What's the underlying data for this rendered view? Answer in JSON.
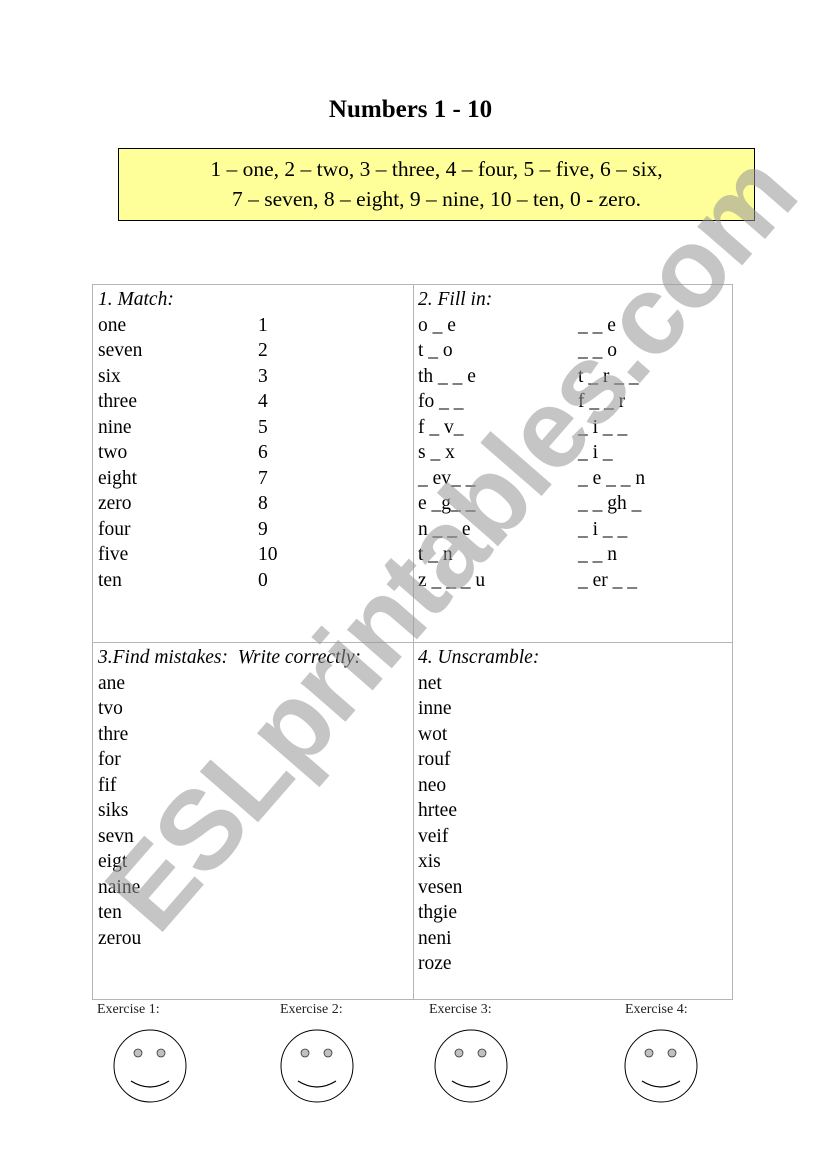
{
  "title": "Numbers 1 - 10",
  "reference": {
    "line1": "1 – one, 2 – two, 3 – three, 4 – four, 5 – five, 6 – six,",
    "line2": "7 – seven, 8 – eight, 9 – nine, 10 – ten, 0 - zero.",
    "background": "#ffff99"
  },
  "exercises": {
    "match": {
      "heading": "1. Match:",
      "words": [
        "one",
        "seven",
        "six",
        "three",
        "nine",
        "two",
        "eight",
        "zero",
        "four",
        "five",
        "ten"
      ],
      "numbers": [
        "1",
        "2",
        "3",
        "4",
        "5",
        "6",
        "7",
        "8",
        "9",
        "10",
        "0"
      ]
    },
    "fill_in": {
      "heading": "2. Fill in:",
      "left": [
        "o _ e",
        "t _ o",
        "th _ _ e",
        "fo _ _",
        "f _ v_",
        "s _ x",
        "_ ev_ _",
        "e _g_ _",
        "n _ _ e",
        "t _ n",
        "z _ _ _ u"
      ],
      "right": [
        "_ _ e",
        "_ _ o",
        "t _ r _ _",
        "f _ _ r",
        "_ i _ _",
        "_ i _",
        "_ e _ _ n",
        "_ _ gh _",
        "_ i _ _",
        "_ _ n",
        "_ er _ _"
      ]
    },
    "find_mistakes": {
      "heading": "3.Find mistakes:  Write correctly:",
      "words": [
        "ane",
        "tvo",
        "thre",
        "for",
        "fif",
        "siks",
        "sevn",
        "eigt",
        "naine",
        "ten",
        "zerou"
      ]
    },
    "unscramble": {
      "heading": "4. Unscramble:",
      "words": [
        "net",
        "inne",
        "wot",
        "rouf",
        "neo",
        "hrtee",
        "veif",
        "xis",
        "vesen",
        "thgie",
        "neni",
        "roze"
      ]
    }
  },
  "footer": {
    "labels": [
      "Exercise 1:",
      "Exercise 2:",
      "Exercise 3:",
      "Exercise 4:"
    ],
    "icon": "smiley-face-icon"
  },
  "watermark": "ESLprintables.com"
}
